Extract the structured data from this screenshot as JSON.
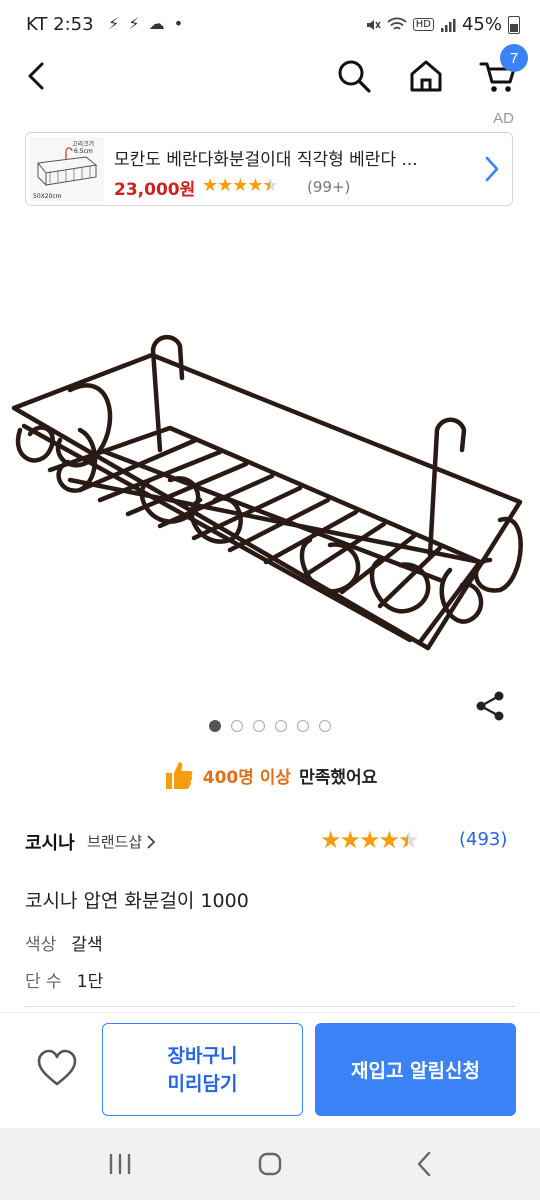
{
  "status_bar": {
    "time": "KT 2:53",
    "left_icons": "⚡ ⚡ ☁ •",
    "battery": "45%",
    "hd": "HD"
  },
  "header": {
    "cart_count": "7"
  },
  "ad": {
    "label": "AD",
    "title": "모칸도 베란다화분걸이대 직각형 베란다 ...",
    "price": "23,000원",
    "rating_count": "(99+)",
    "thumb_label_top": "고리크기",
    "thumb_label_size": "6.5cm",
    "thumb_label_dim": "50X20cm",
    "rating": 4.5
  },
  "gallery": {
    "total": 6,
    "active_index": 0
  },
  "satisfaction": {
    "count_text": "400명 이상",
    "suffix_text": "만족했어요"
  },
  "product": {
    "brand": "코시나",
    "brand_shop": "브랜드샵",
    "rating": 4.5,
    "review_count": "(493)",
    "title": "코시나 압연 화분걸이 1000",
    "options": [
      {
        "label": "색상",
        "value": "갈색"
      },
      {
        "label": "단 수",
        "value": "1단"
      }
    ]
  },
  "actions": {
    "cart_line1": "장바구니",
    "cart_line2": "미리담기",
    "restock": "재입고 알림신청"
  },
  "colors": {
    "accent": "#3b82f6",
    "price": "#d0221c",
    "star": "#f59e0b",
    "satisfaction": "#e0701b",
    "product_frame": "#2a1a16"
  }
}
